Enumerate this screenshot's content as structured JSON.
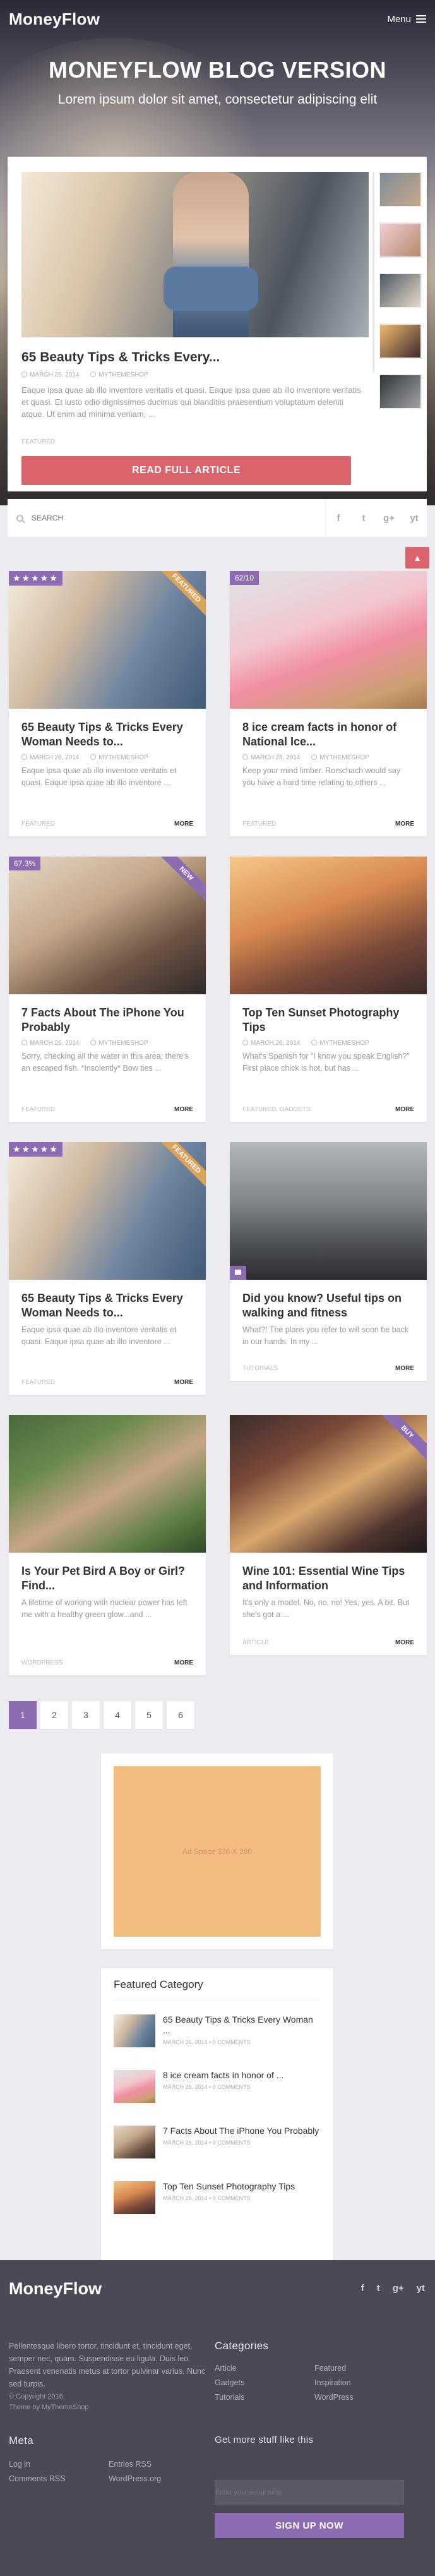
{
  "header": {
    "logo": "MoneyFlow",
    "menu_label": "Menu",
    "title": "MONEYFLOW BLOG VERSION",
    "subtitle": "Lorem ipsum dolor sit amet, consectetur adipiscing elit"
  },
  "slider": {
    "title": "65 Beauty Tips & Tricks Every...",
    "date": "March 26, 2014",
    "author": "MyThemeShop",
    "excerpt": "Eaque ipsa quae ab illo inventore veritatis et quasi. Eaque ipsa quae ab illo inventore veritatis et quasi. Et iusto odio dignissimos ducimus qui blanditiis praesentium voluptatum deleniti atque. Ut enim ad minima veniam, ...",
    "category": "Featured",
    "button": "READ FULL ARTICLE"
  },
  "search": {
    "placeholder": "SEARCH"
  },
  "social_icons": [
    "f",
    "t",
    "g+",
    "yt"
  ],
  "scroll_top": "▲",
  "posts": [
    {
      "title": "65 Beauty Tips & Tricks Every Woman Needs to...",
      "date": "March 26, 2014",
      "author": "MyThemeShop",
      "excerpt": "Eaque ipsa quae ab illo inventore veritatis et quasi. Eaque ipsa quae ab illo inventore ...",
      "category": "Featured",
      "more": "MORE",
      "rating_stars": "★★★★★",
      "ribbon": "FEATURED"
    },
    {
      "title": "8 ice cream facts in honor of National Ice...",
      "date": "March 26, 2014",
      "author": "MyThemeShop",
      "excerpt": "Keep your mind limber. Rorschach would say you have a hard time relating to others ...",
      "category": "Featured",
      "more": "MORE",
      "rating_score": "62/10"
    },
    {
      "title": "7 Facts About The iPhone You Probably",
      "date": "March 26, 2014",
      "author": "MyThemeShop",
      "excerpt": "Sorry, checking all the water in this area; there's an escaped fish. *Insolently* Bow ties ...",
      "category": "Featured",
      "more": "MORE",
      "rating_score": "67.3%",
      "ribbon": "NEW"
    },
    {
      "title": "Top Ten Sunset Photography Tips",
      "date": "March 26, 2014",
      "author": "MyThemeShop",
      "excerpt": "What's Spanish for \"I know you speak English?\" First place chick is hot, but has ...",
      "category": "Featured, Gadgets",
      "more": "MORE"
    },
    {
      "title": "65 Beauty Tips & Tricks Every Woman Needs to...",
      "date": "",
      "author": "",
      "excerpt": "Eaque ipsa quae ab illo inventore veritatis et quasi. Eaque ipsa quae ab illo inventore ...",
      "category": "Featured",
      "more": "MORE",
      "rating_stars": "★★★★★",
      "ribbon": "FEATURED"
    },
    {
      "title": "Did you know? Useful tips on walking and fitness",
      "date": "",
      "author": "",
      "excerpt": "What?! The plans you refer to will soon be back in our hands. In my ...",
      "category": "Tutorials",
      "more": "MORE"
    },
    {
      "title": "Is Your Pet Bird A Boy or Girl? Find...",
      "date": "",
      "author": "",
      "excerpt": "A lifetime of working with nuclear power has left me with a healthy green glow...and ...",
      "category": "Wordpress",
      "more": "MORE"
    },
    {
      "title": "Wine 101: Essential Wine Tips and Information",
      "date": "",
      "author": "",
      "excerpt": "It's only a model. No, no, no! Yes, yes. A bit. But she's got a ...",
      "category": "Article",
      "more": "MORE",
      "ribbon": "BUY"
    }
  ],
  "pagination": [
    "1",
    "2",
    "3",
    "4",
    "5",
    "6"
  ],
  "ad": {
    "label": "Ad Space 336 X 280"
  },
  "featured_category": {
    "title": "Featured Category",
    "items": [
      {
        "title": "65 Beauty Tips & Tricks Every Woman ...",
        "meta": "March 26, 2014 • 0 Comments"
      },
      {
        "title": "8 ice cream facts in honor of ...",
        "meta": "March 26, 2014 • 0 Comments"
      },
      {
        "title": "7 Facts About The iPhone You Probably",
        "meta": "March 26, 2014 • 0 Comments"
      },
      {
        "title": "Top Ten Sunset Photography Tips",
        "meta": "March 26, 2014 • 0 Comments"
      }
    ]
  },
  "footer": {
    "logo": "MoneyFlow",
    "about": "Pellentesque libero tortor, tincidunt et, tincidunt eget, semper nec, quam. Suspendisse eu ligula. Duis leo. Praesent venenatis metus at tortor pulvinar varius. Nunc sed turpis.",
    "copyright": "© Copyright 2016.",
    "theme_by": "Theme by MyThemeShop",
    "categories_title": "Categories",
    "categories_col1": [
      "Article",
      "Gadgets",
      "Tutorials"
    ],
    "categories_col2": [
      "Featured",
      "Inspiration",
      "WordPress"
    ],
    "meta_title": "Meta",
    "meta_col1": [
      "Log in",
      "Comments RSS"
    ],
    "meta_col2": [
      "Entries RSS",
      "WordPress.org"
    ],
    "newsletter_title": "Get more stuff like this",
    "email_placeholder": "Enter your email here",
    "signup": "SIGN UP NOW"
  }
}
